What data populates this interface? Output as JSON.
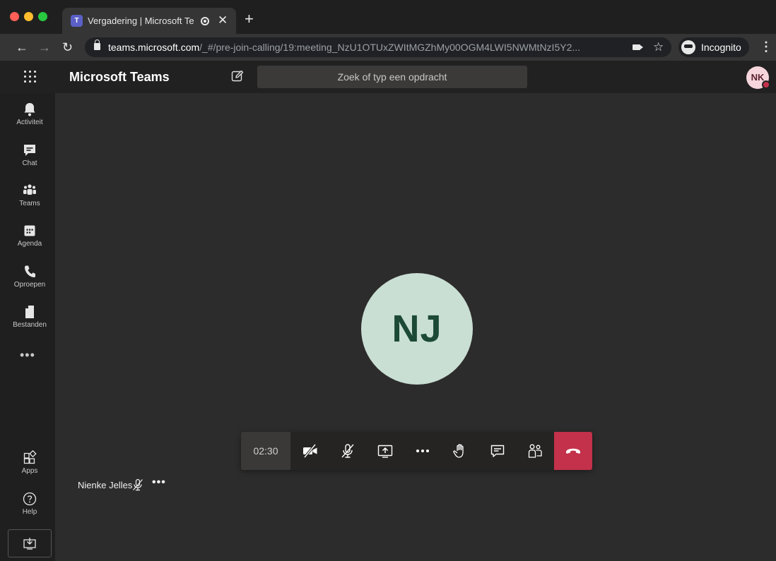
{
  "browser": {
    "tab_title": "Vergadering | Microsoft Teams",
    "url_host": "teams.microsoft.com",
    "url_path": "/_#/pre-join-calling/19:meeting_NzU1OTUxZWItMGZhMy00OGM4LWI5NWMtNzI5Y2...",
    "incognito_label": "Incognito"
  },
  "header": {
    "app_title": "Microsoft Teams",
    "search_placeholder": "Zoek of typ een opdracht",
    "user_initials": "NK"
  },
  "rail": {
    "items": [
      {
        "label": "Activiteit",
        "icon": "bell-icon"
      },
      {
        "label": "Chat",
        "icon": "chat-icon"
      },
      {
        "label": "Teams",
        "icon": "teams-icon"
      },
      {
        "label": "Agenda",
        "icon": "calendar-icon"
      },
      {
        "label": "Oproepen",
        "icon": "phone-icon"
      },
      {
        "label": "Bestanden",
        "icon": "file-icon"
      }
    ],
    "more": "•••",
    "bottom_items": [
      {
        "label": "Apps",
        "icon": "apps-icon"
      },
      {
        "label": "Help",
        "icon": "help-icon"
      }
    ]
  },
  "meeting": {
    "remote_initials": "NJ",
    "timer": "02:30",
    "participant_name": "Nienke Jelles",
    "participant_more": "•••"
  },
  "colors": {
    "accent": "#5b5fc7",
    "hangup": "#c4314b",
    "avatar_bg": "#cadfd4",
    "avatar_text": "#1c4a36",
    "presence_busy": "#c4314b"
  }
}
